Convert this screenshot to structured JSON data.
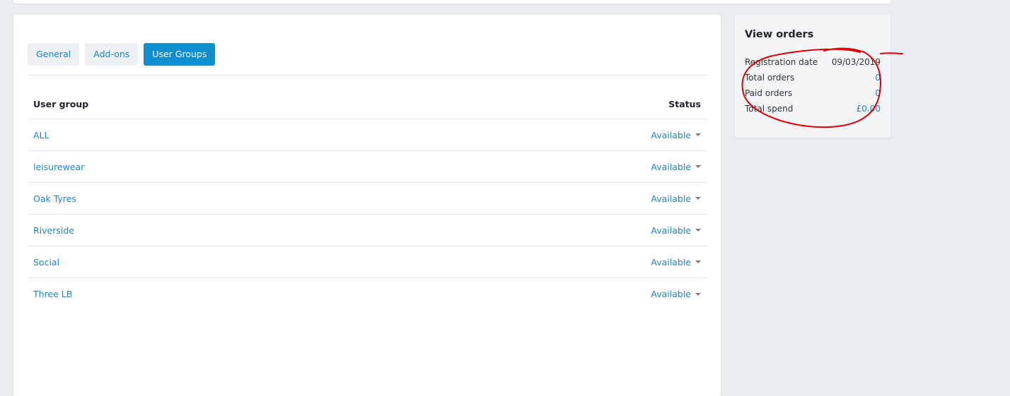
{
  "tabs": [
    {
      "label": "General",
      "active": false
    },
    {
      "label": "Add-ons",
      "active": false
    },
    {
      "label": "User Groups",
      "active": true
    }
  ],
  "table": {
    "headers": {
      "user_group": "User group",
      "status": "Status"
    },
    "rows": [
      {
        "name": "ALL",
        "status": "Available"
      },
      {
        "name": "leisurewear",
        "status": "Available"
      },
      {
        "name": "Oak Tyres",
        "status": "Available"
      },
      {
        "name": "Riverside",
        "status": "Available"
      },
      {
        "name": "Social",
        "status": "Available"
      },
      {
        "name": "Three LB",
        "status": "Available"
      }
    ]
  },
  "orders": {
    "title": "View orders",
    "rows": [
      {
        "label": "Registration date",
        "value": "09/03/2019"
      },
      {
        "label": "Total orders",
        "value": "0"
      },
      {
        "label": "Paid orders",
        "value": "0"
      },
      {
        "label": "Total spend",
        "value": "£0.00"
      }
    ]
  },
  "colors": {
    "accent": "#0f8ed1",
    "link": "#1d84c6",
    "annotation": "#e00000",
    "background": "#e9edf1"
  }
}
